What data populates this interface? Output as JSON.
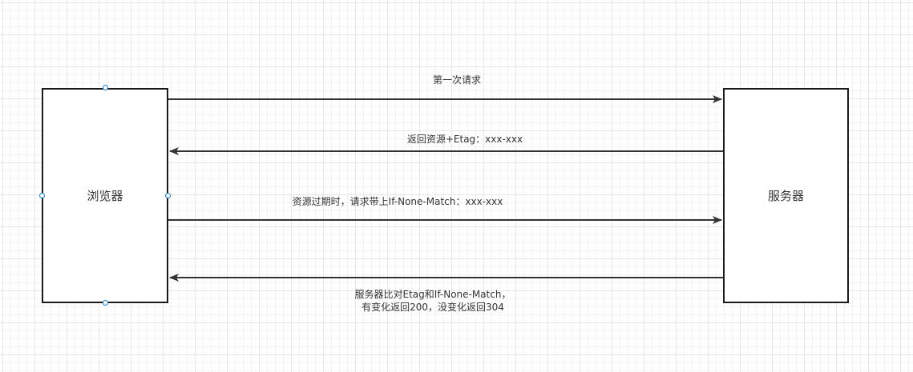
{
  "nodes": {
    "browser": "浏览器",
    "server": "服务器"
  },
  "messages": [
    {
      "text": "第一次请求",
      "direction": "browser-to-server"
    },
    {
      "text": "返回资源+Etag：xxx-xxx",
      "direction": "server-to-browser"
    },
    {
      "text": "资源过期时，请求带上If-None-Match：xxx-xxx",
      "direction": "browser-to-server"
    },
    {
      "text_lines": [
        "服务器比对Etag和If-None-Match，",
        "有变化返回200，没变化返回304"
      ],
      "direction": "server-to-browser"
    }
  ],
  "colors": {
    "line": "#333333",
    "box_border": "#1a1a1a",
    "handle": "#1f7ec4"
  }
}
